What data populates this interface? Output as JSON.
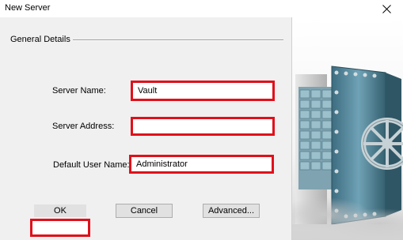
{
  "window": {
    "title": "New Server"
  },
  "group": {
    "label": "General Details"
  },
  "fields": {
    "server_name": {
      "label": "Server Name:",
      "value": "Vault"
    },
    "server_address": {
      "label": "Server Address:",
      "value": ""
    },
    "default_user": {
      "label": "Default User Name:",
      "value": "Administrator"
    }
  },
  "buttons": {
    "ok": "OK",
    "cancel": "Cancel",
    "advanced": "Advanced..."
  },
  "colors": {
    "highlight": "#e0101a",
    "dialog_bg": "#f0f0f0",
    "vault_door": "#5f8fa3"
  },
  "image": {
    "icon": "bank-vault-illustration"
  }
}
